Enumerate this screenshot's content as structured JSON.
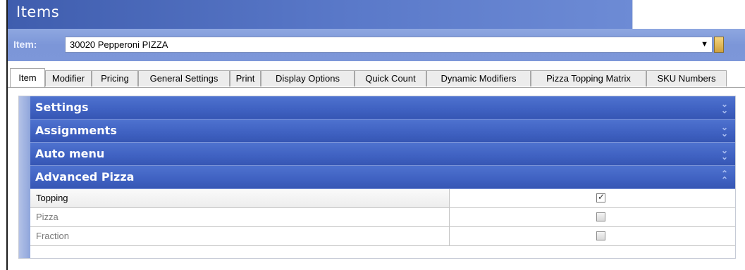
{
  "window": {
    "title": "Items"
  },
  "item_selector": {
    "label": "Item:",
    "value": "30020 Pepperoni PIZZA",
    "dropdown_icon": "chevron-down-icon",
    "side_icon": "calendar-icon"
  },
  "tabs": [
    {
      "label": "Item",
      "active": true
    },
    {
      "label": "Modifier",
      "active": false
    },
    {
      "label": "Pricing",
      "active": false
    },
    {
      "label": "General Settings",
      "active": false
    },
    {
      "label": "Print",
      "active": false
    },
    {
      "label": "Display Options",
      "active": false
    },
    {
      "label": "Quick Count",
      "active": false
    },
    {
      "label": "Dynamic Modifiers",
      "active": false
    },
    {
      "label": "Pizza Topping Matrix",
      "active": false
    },
    {
      "label": "SKU Numbers",
      "active": false
    }
  ],
  "sections": [
    {
      "title": "Settings",
      "state": "collapsed",
      "icon": "double-chevron-down-icon"
    },
    {
      "title": "Assignments",
      "state": "collapsed",
      "icon": "double-chevron-down-icon"
    },
    {
      "title": "Auto menu",
      "state": "collapsed",
      "icon": "double-chevron-down-icon"
    },
    {
      "title": "Advanced Pizza",
      "state": "expanded",
      "icon": "double-chevron-up-icon"
    }
  ],
  "advanced_pizza": [
    {
      "label": "Topping",
      "checked": true,
      "enabled": true
    },
    {
      "label": "Pizza",
      "checked": false,
      "enabled": false
    },
    {
      "label": "Fraction",
      "checked": false,
      "enabled": false
    }
  ],
  "colors": {
    "title_bar": "#4a68b8",
    "section_header": "#3f61c1",
    "item_bar": "#7e98d9"
  }
}
